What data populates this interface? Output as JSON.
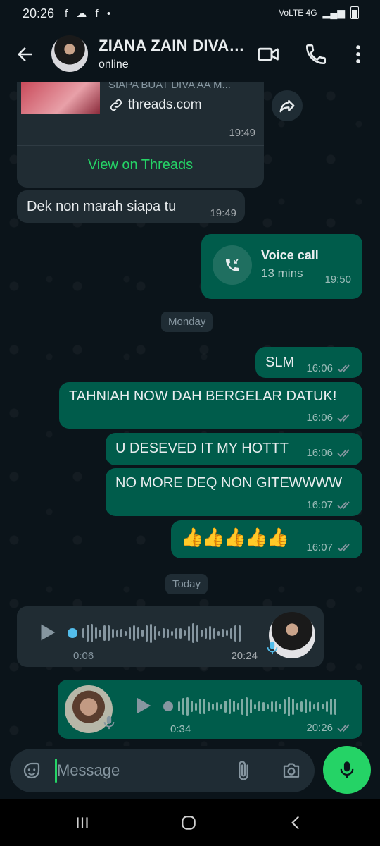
{
  "status": {
    "time": "20:26",
    "left_icons": "f ☁ f •",
    "network": "VoLTE 4G",
    "signal": "signal-icon",
    "battery": "battery-icon"
  },
  "header": {
    "name": "ZIANA ZAIN DIVA…",
    "status": "online"
  },
  "chat": {
    "link_card": {
      "title_fragment": "SIAPA BUAT DIVA AA M...",
      "domain": "threads.com",
      "time": "19:49",
      "cta": "View on Threads"
    },
    "messages": [
      {
        "text": "Dek non marah siapa tu",
        "time": "19:49",
        "dir": "in"
      },
      {
        "call_title": "Voice call",
        "call_duration": "13 mins",
        "time": "19:50",
        "dir": "out"
      },
      {
        "text": "SLM",
        "time": "16:06",
        "dir": "out"
      },
      {
        "text": "TAHNIAH NOW DAH BERGELAR DATUK!",
        "time": "16:06",
        "dir": "out"
      },
      {
        "text": "U DESEVED IT MY HOTTT",
        "time": "16:06",
        "dir": "out"
      },
      {
        "text": "NO MORE DEQ NON GITEWWWW",
        "time": "16:07",
        "dir": "out"
      },
      {
        "text": "👍👍👍👍👍",
        "time": "16:07",
        "dir": "out"
      }
    ],
    "dates": {
      "monday": "Monday",
      "today": "Today"
    },
    "voice_in": {
      "duration": "0:06",
      "time": "20:24",
      "progress": 0
    },
    "voice_out": {
      "duration": "0:34",
      "time": "20:26",
      "progress": 0
    }
  },
  "composer": {
    "placeholder": "Message"
  },
  "colors": {
    "bg": "#0b141a",
    "incoming": "#202c33",
    "outgoing": "#005c4b",
    "accent": "#25d366",
    "tick": "#8696a0"
  }
}
